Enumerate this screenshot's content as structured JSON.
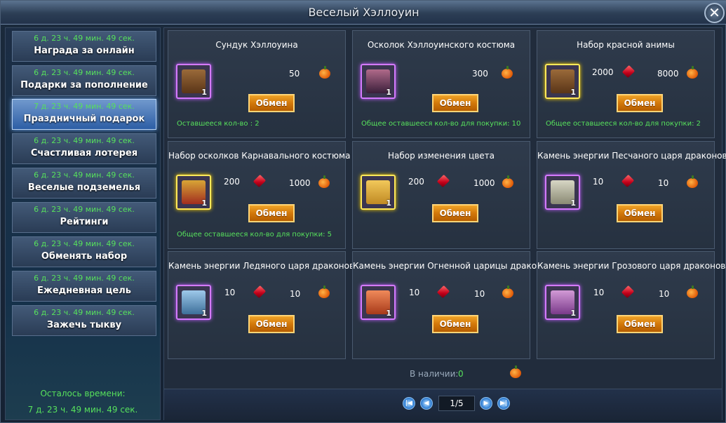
{
  "window": {
    "title": "Веселый Хэллоуин",
    "close_symbol": "✕"
  },
  "sidebar": {
    "items": [
      {
        "time": "6 д. 23 ч. 49 мин. 49 сек.",
        "label": "Награда за онлайн"
      },
      {
        "time": "6 д. 23 ч. 49 мин. 49 сек.",
        "label": "Подарки за пополнение"
      },
      {
        "time": "7 д. 23 ч. 49 мин. 49 сек.",
        "label": "Праздничный подарок",
        "active": true
      },
      {
        "time": "6 д. 23 ч. 49 мин. 49 сек.",
        "label": "Счастливая лотерея"
      },
      {
        "time": "6 д. 23 ч. 49 мин. 49 сек.",
        "label": "Веселые подземелья"
      },
      {
        "time": "6 д. 23 ч. 49 мин. 49 сек.",
        "label": "Рейтинги"
      },
      {
        "time": "6 д. 23 ч. 49 мин. 49 сек.",
        "label": "Обменять набор"
      },
      {
        "time": "6 д. 23 ч. 49 мин. 49 сек.",
        "label": "Ежедневная цель"
      },
      {
        "time": "6 д. 23 ч. 49 мин. 49 сек.",
        "label": "Зажечь тыкву"
      }
    ],
    "remaining_label": "Осталось времени:",
    "remaining_time": "7 д. 23 ч. 49 мин. 49 сек."
  },
  "items": [
    {
      "title": "Сундук Хэллоуина",
      "qty": "1",
      "ruby": "",
      "pumpkin": "50",
      "button": "Обмен",
      "note": "Оставшееся кол-во : 2",
      "frame": "purple",
      "icon": "chest-icon"
    },
    {
      "title": "Осколок Хэллоуинского костюма",
      "qty": "1",
      "ruby": "",
      "pumpkin": "300",
      "button": "Обмен",
      "note": "Общее оставшееся кол-во для покупки: 10",
      "frame": "purple",
      "icon": "costume-shard-icon"
    },
    {
      "title": "Набор красной анимы",
      "qty": "1",
      "ruby": "2000",
      "pumpkin": "8000",
      "button": "Обмен",
      "note": "Общее оставшееся кол-во для покупки: 2",
      "frame": "gold",
      "icon": "chest-icon"
    },
    {
      "title": "Набор осколков Карнавального костюма",
      "qty": "1",
      "ruby": "200",
      "pumpkin": "1000",
      "button": "Обмен",
      "note": "Общее оставшееся кол-во для покупки: 5",
      "frame": "gold",
      "icon": "gift-box-icon"
    },
    {
      "title": "Набор изменения цвета",
      "qty": "1",
      "ruby": "200",
      "pumpkin": "1000",
      "button": "Обмен",
      "note": "",
      "frame": "gold",
      "icon": "gift-box-icon"
    },
    {
      "title": "Камень энергии Песчаного царя драконов",
      "qty": "1",
      "ruby": "10",
      "pumpkin": "10",
      "button": "Обмен",
      "note": "",
      "frame": "purple",
      "icon": "energy-stone-icon"
    },
    {
      "title": "Камень энергии Ледяного царя драконов",
      "qty": "1",
      "ruby": "10",
      "pumpkin": "10",
      "button": "Обмен",
      "note": "",
      "frame": "purple",
      "icon": "energy-stone-icon"
    },
    {
      "title": "Камень энергии Огненной царицы драконов",
      "qty": "1",
      "ruby": "10",
      "pumpkin": "10",
      "button": "Обмен",
      "note": "",
      "frame": "purple",
      "icon": "energy-stone-icon"
    },
    {
      "title": "Камень энергии Грозового царя драконов",
      "qty": "1",
      "ruby": "10",
      "pumpkin": "10",
      "button": "Обмен",
      "note": "",
      "frame": "purple",
      "icon": "energy-stone-icon"
    }
  ],
  "footer": {
    "available_label": "В наличии:",
    "available_value": "0",
    "page": "1/5"
  },
  "colors": {
    "timer_green": "#57e15c",
    "exchange_orange": "#d2780a",
    "active_blue": "#2d5ea5",
    "frame_purple": "#d47aff",
    "frame_gold": "#ffe85a"
  }
}
